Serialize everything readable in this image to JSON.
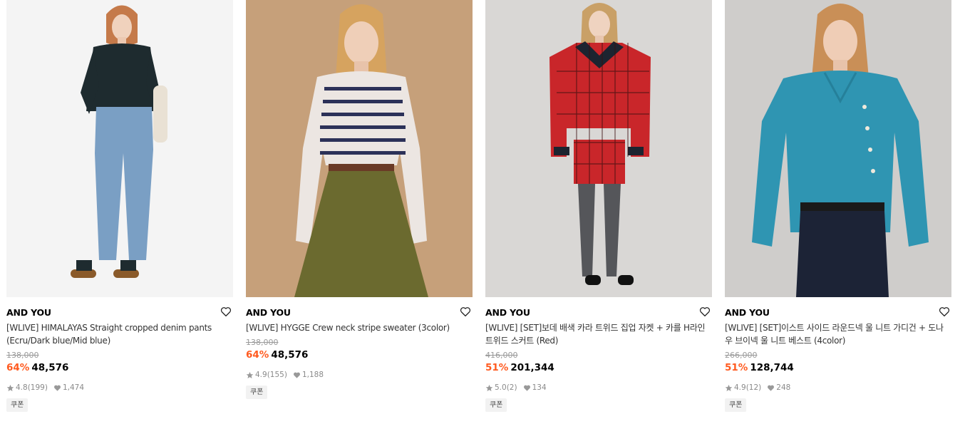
{
  "colors": {
    "discount": "#ff5a1f",
    "original_price": "#9a9a9a",
    "meta_text": "#8a8a8a",
    "coupon_bg": "#f2f2f2"
  },
  "icons": {
    "wishlist": "heart-outline-icon",
    "rating": "star-icon",
    "likes": "heart-filled-icon"
  },
  "products": [
    {
      "brand": "AND YOU",
      "title": "[WLIVE] HIMALAYAS Straight cropped denim pants (Ecru/Dark blue/Mid blue)",
      "original_price": "138,000",
      "discount_rate": "64%",
      "price": "48,576",
      "rating": "4.8",
      "reviews": "(199)",
      "likes": "1,474",
      "coupon": "쿠폰"
    },
    {
      "brand": "AND YOU",
      "title": "[WLIVE] HYGGE Crew neck stripe sweater (3color)",
      "original_price": "138,000",
      "discount_rate": "64%",
      "price": "48,576",
      "rating": "4.9",
      "reviews": "(155)",
      "likes": "1,188",
      "coupon": "쿠폰"
    },
    {
      "brand": "AND YOU",
      "title": "[WLIVE] [SET]보데 배색 카라 트위드 집업 자켓 + 카를 H라인 트위드 스커트 (Red)",
      "original_price": "416,000",
      "discount_rate": "51%",
      "price": "201,344",
      "rating": "5.0",
      "reviews": "(2)",
      "likes": "134",
      "coupon": "쿠폰"
    },
    {
      "brand": "AND YOU",
      "title": "[WLIVE] [SET]이스트 사이드 라운드넥 울 니트 가디건 + 도나우 브이넥 울 니트 베스트 (4color)",
      "original_price": "266,000",
      "discount_rate": "51%",
      "price": "128,744",
      "rating": "4.9",
      "reviews": "(12)",
      "likes": "248",
      "coupon": "쿠폰"
    }
  ]
}
